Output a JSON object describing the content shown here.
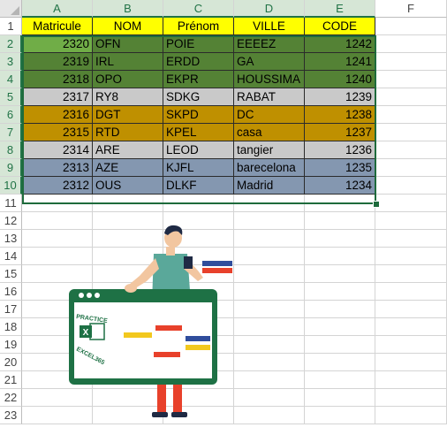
{
  "columns": [
    "A",
    "B",
    "C",
    "D",
    "E",
    "F"
  ],
  "rows": [
    "1",
    "2",
    "3",
    "4",
    "5",
    "6",
    "7",
    "8",
    "9",
    "10",
    "11",
    "12",
    "13",
    "14",
    "15",
    "16",
    "17",
    "18",
    "19",
    "20",
    "21",
    "22",
    "23"
  ],
  "header": [
    "Matricule",
    "NOM",
    "Prénom",
    "VILLE",
    "CODE"
  ],
  "data": [
    {
      "matricule": "2320",
      "nom": "OFN",
      "prenom": "POIE",
      "ville": "EEEEZ",
      "code": "1242"
    },
    {
      "matricule": "2319",
      "nom": "IRL",
      "prenom": "ERDD",
      "ville": "GA",
      "code": "1241"
    },
    {
      "matricule": "2318",
      "nom": "OPO",
      "prenom": "EKPR",
      "ville": "HOUSSIMA",
      "code": "1240"
    },
    {
      "matricule": "2317",
      "nom": "RY8",
      "prenom": "SDKG",
      "ville": "RABAT",
      "code": "1239"
    },
    {
      "matricule": "2316",
      "nom": "DGT",
      "prenom": "SKPD",
      "ville": "DC",
      "code": "1238"
    },
    {
      "matricule": "2315",
      "nom": "RTD",
      "prenom": "KPEL",
      "ville": "casa",
      "code": "1237"
    },
    {
      "matricule": "2314",
      "nom": "ARE",
      "prenom": "LEOD",
      "ville": "tangier",
      "code": "1236"
    },
    {
      "matricule": "2313",
      "nom": "AZE",
      "prenom": "KJFL",
      "ville": "barecelona",
      "code": "1235"
    },
    {
      "matricule": "2312",
      "nom": "OUS",
      "prenom": "DLKF",
      "ville": "Madrid",
      "code": "1234"
    }
  ],
  "colors": {
    "header_fill": "#ffff00",
    "first_cell_fill": "#70ad47",
    "green_fill": "#548235",
    "gray_fill": "#c9c9c9",
    "gold_fill": "#bf9000",
    "blue_fill": "#8497b0",
    "selection": "#1e6b3c"
  },
  "illustration": {
    "line1": "PRACTICE",
    "line2": "EXCEL365"
  }
}
